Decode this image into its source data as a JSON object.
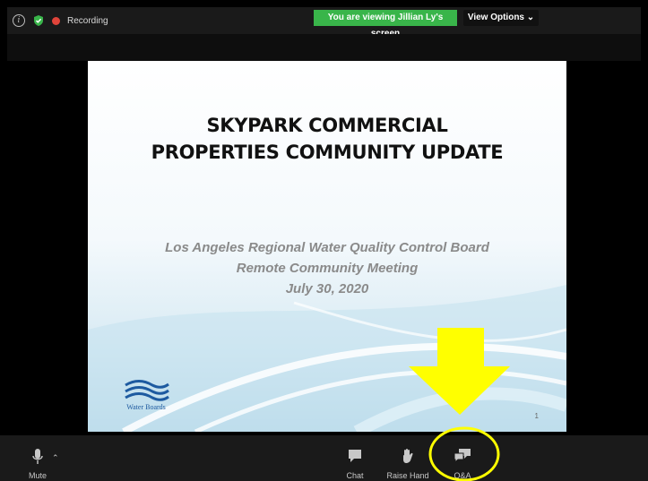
{
  "topbar": {
    "recording_label": "Recording",
    "viewing_banner": "You are viewing Jillian Ly's screen",
    "view_options_label": "View Options ⌄"
  },
  "slide": {
    "title_lines": [
      "SKYPARK COMMERCIAL",
      "PROPERTIES COMMUNITY UPDATE"
    ],
    "subtitle_lines": [
      "Los Angeles Regional Water Quality Control Board",
      "Remote Community Meeting",
      "July 30, 2020"
    ],
    "logo_text": "Water Boards",
    "page_number": "1"
  },
  "toolbar": {
    "mute_label": "Mute",
    "chat_label": "Chat",
    "raise_hand_label": "Raise Hand",
    "qa_label": "Q&A"
  },
  "colors": {
    "banner_green": "#39b54a",
    "annotation_yellow": "#ffff00",
    "recording_red": "#e0443a"
  },
  "icons": [
    "info-icon",
    "shield-icon",
    "recording-icon",
    "microphone-icon",
    "chat-icon",
    "raise-hand-icon",
    "qa-icon"
  ]
}
